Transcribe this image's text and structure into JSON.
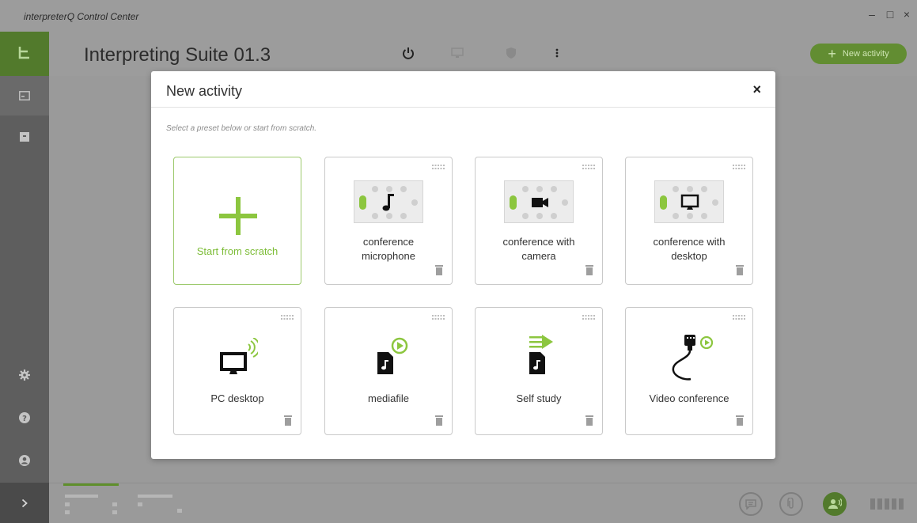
{
  "window": {
    "title": "interpreterQ Control Center",
    "controls": [
      "–",
      "□",
      "×"
    ]
  },
  "header": {
    "suite_title": "Interpreting Suite 01.3",
    "icons": [
      "power-icon",
      "monitor-icon",
      "shield-icon",
      "more-vertical-icon"
    ],
    "new_activity_label": "New activity"
  },
  "rail": {
    "items": [
      "logo-icon",
      "calendar-icon",
      "archive-icon",
      "gear-icon",
      "help-icon",
      "user-icon",
      "chevron-right-icon"
    ]
  },
  "modal": {
    "title": "New activity",
    "close": "×",
    "hint": "Select a preset below or start from scratch.",
    "cards": [
      {
        "label": "Start from scratch",
        "icon": "plus-icon"
      },
      {
        "label": "conference microphone",
        "line1": "conference",
        "line2": "microphone",
        "icon": "music-note-icon"
      },
      {
        "label": "conference with camera",
        "line1": "conference with",
        "line2": "camera",
        "icon": "video-camera-icon"
      },
      {
        "label": "conference with desktop",
        "line1": "conference with",
        "line2": "desktop",
        "icon": "monitor-icon"
      },
      {
        "label": "PC desktop",
        "icon": "desktop-cast-icon"
      },
      {
        "label": "mediafile",
        "icon": "media-file-icon"
      },
      {
        "label": "Self study",
        "icon": "self-study-icon"
      },
      {
        "label": "Video conference",
        "icon": "video-cable-icon"
      }
    ]
  },
  "footer": {
    "icons": [
      "chat-icon",
      "attachment-icon",
      "interpreter-icon",
      "signal-bars-icon"
    ]
  },
  "colors": {
    "accent_green": "#7cbc36",
    "dark_green": "#527a2c",
    "overlay_gray": "#9a9a9a",
    "rail_gray": "#5e5e5e"
  }
}
